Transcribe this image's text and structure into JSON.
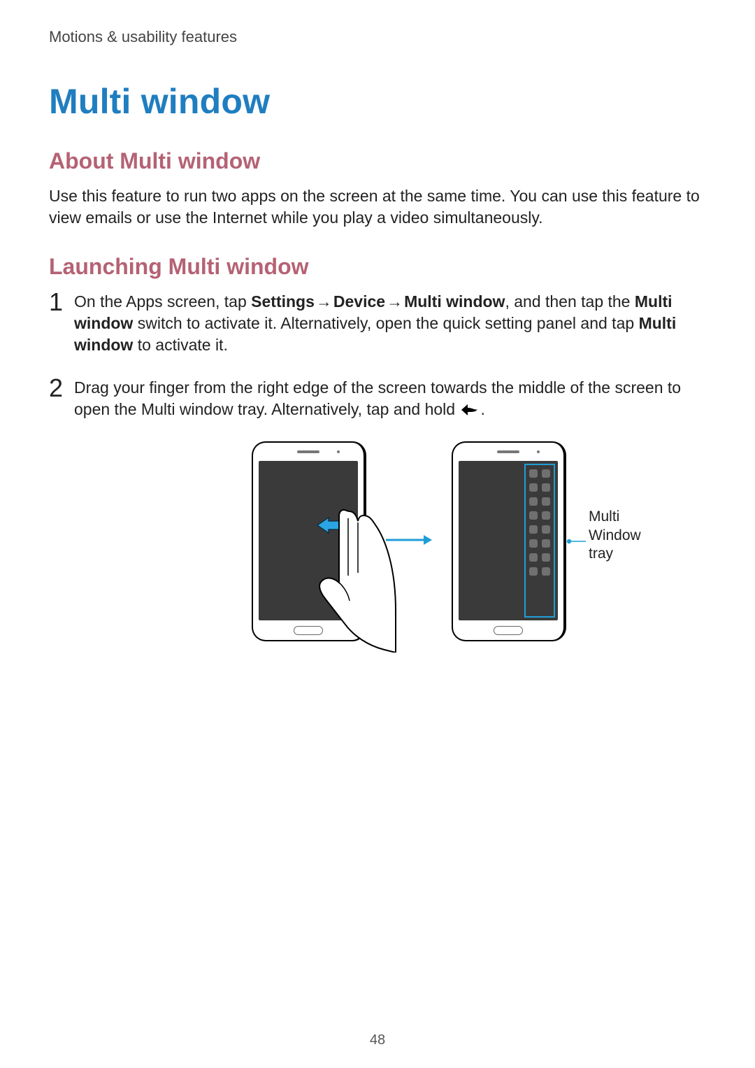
{
  "breadcrumb": "Motions & usability features",
  "h1": "Multi window",
  "about": {
    "heading": "About Multi window",
    "text": "Use this feature to run two apps on the screen at the same time. You can use this feature to view emails or use the Internet while you play a video simultaneously."
  },
  "launch": {
    "heading": "Launching Multi window",
    "steps": [
      {
        "num": "1",
        "prefix": "On the Apps screen, tap ",
        "nav1": "Settings",
        "arrow": " → ",
        "nav2": "Device",
        "nav3": "Multi window",
        "mid": ", and then tap the ",
        "switch_label": "Multi window",
        "after_switch": " switch to activate it. Alternatively, open the quick setting panel and tap ",
        "panel_label": "Multi window",
        "suffix": " to activate it."
      },
      {
        "num": "2",
        "prefix": "Drag your finger from the right edge of the screen towards the middle of the screen to open the Multi window tray. Alternatively, tap and hold ",
        "suffix": "."
      }
    ]
  },
  "figure": {
    "callout": "Multi Window tray"
  },
  "page_number": "48"
}
